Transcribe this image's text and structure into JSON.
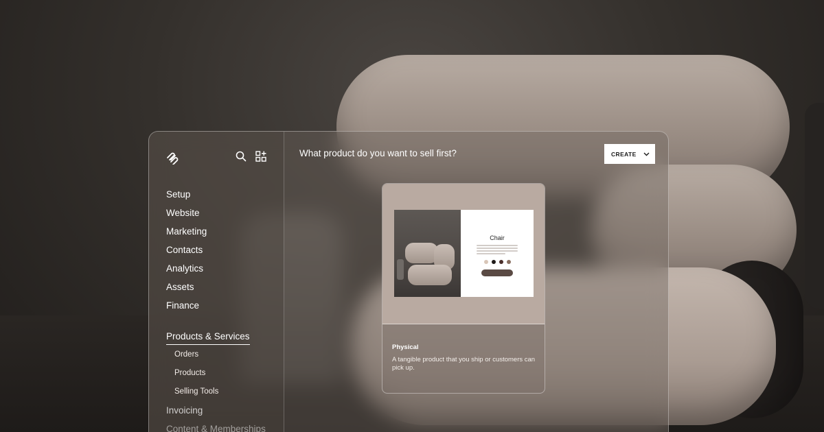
{
  "sidebar": {
    "icons": [
      "squarespace-logo",
      "search-icon",
      "add-block-icon"
    ],
    "items": [
      {
        "label": "Setup"
      },
      {
        "label": "Website"
      },
      {
        "label": "Marketing"
      },
      {
        "label": "Contacts"
      },
      {
        "label": "Analytics"
      },
      {
        "label": "Assets"
      },
      {
        "label": "Finance"
      }
    ],
    "active_item": {
      "label": "Products & Services"
    },
    "sub_items": [
      {
        "label": "Orders"
      },
      {
        "label": "Products"
      },
      {
        "label": "Selling Tools"
      }
    ],
    "after_items": [
      {
        "label": "Invoicing"
      },
      {
        "label": "Content & Memberships"
      }
    ]
  },
  "main": {
    "title": "What product do you want to sell first?",
    "create_label": "CREATE"
  },
  "card": {
    "mockup_title": "Chair",
    "swatch_colors": [
      "#d8c6b8",
      "#1e1a18",
      "#4a2e2a",
      "#8a7062"
    ],
    "label": "Physical",
    "description": "A tangible product that you ship or customers can pick up."
  },
  "colors": {
    "accent": "#ffffff",
    "panel": "#6e645e",
    "card_top": "#b9aaa1"
  }
}
